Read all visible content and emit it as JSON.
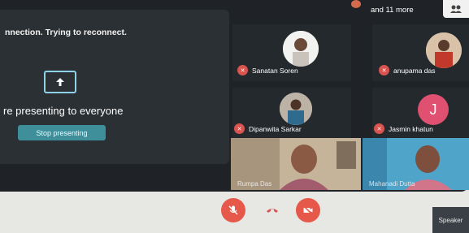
{
  "presentation": {
    "reconnect_text": "nnection. Trying to reconnect.",
    "presenting_text": "re presenting to everyone",
    "stop_label": "Stop presenting",
    "present_icon": "arrow-up-icon"
  },
  "header": {
    "more_text": "and 11 more"
  },
  "participants": [
    {
      "name": "Sanatan Soren"
    },
    {
      "name": "anupama das"
    },
    {
      "name": "Dipanwita Sarkar"
    },
    {
      "name": "Jasmin khatun",
      "initial": "J"
    }
  ],
  "videos": [
    {
      "label": "Rumpa Das"
    },
    {
      "label": "Mahanadi Dutta"
    }
  ],
  "controls": {
    "mic_icon": "mic-off-icon",
    "end_icon": "call-end-icon",
    "cam_icon": "camera-off-icon",
    "speaker_label": "Speaker"
  },
  "colors": {
    "mute_red": "#d9534f",
    "accent_teal": "#3f8f9b",
    "jasmin_avatar": "#e05070"
  }
}
